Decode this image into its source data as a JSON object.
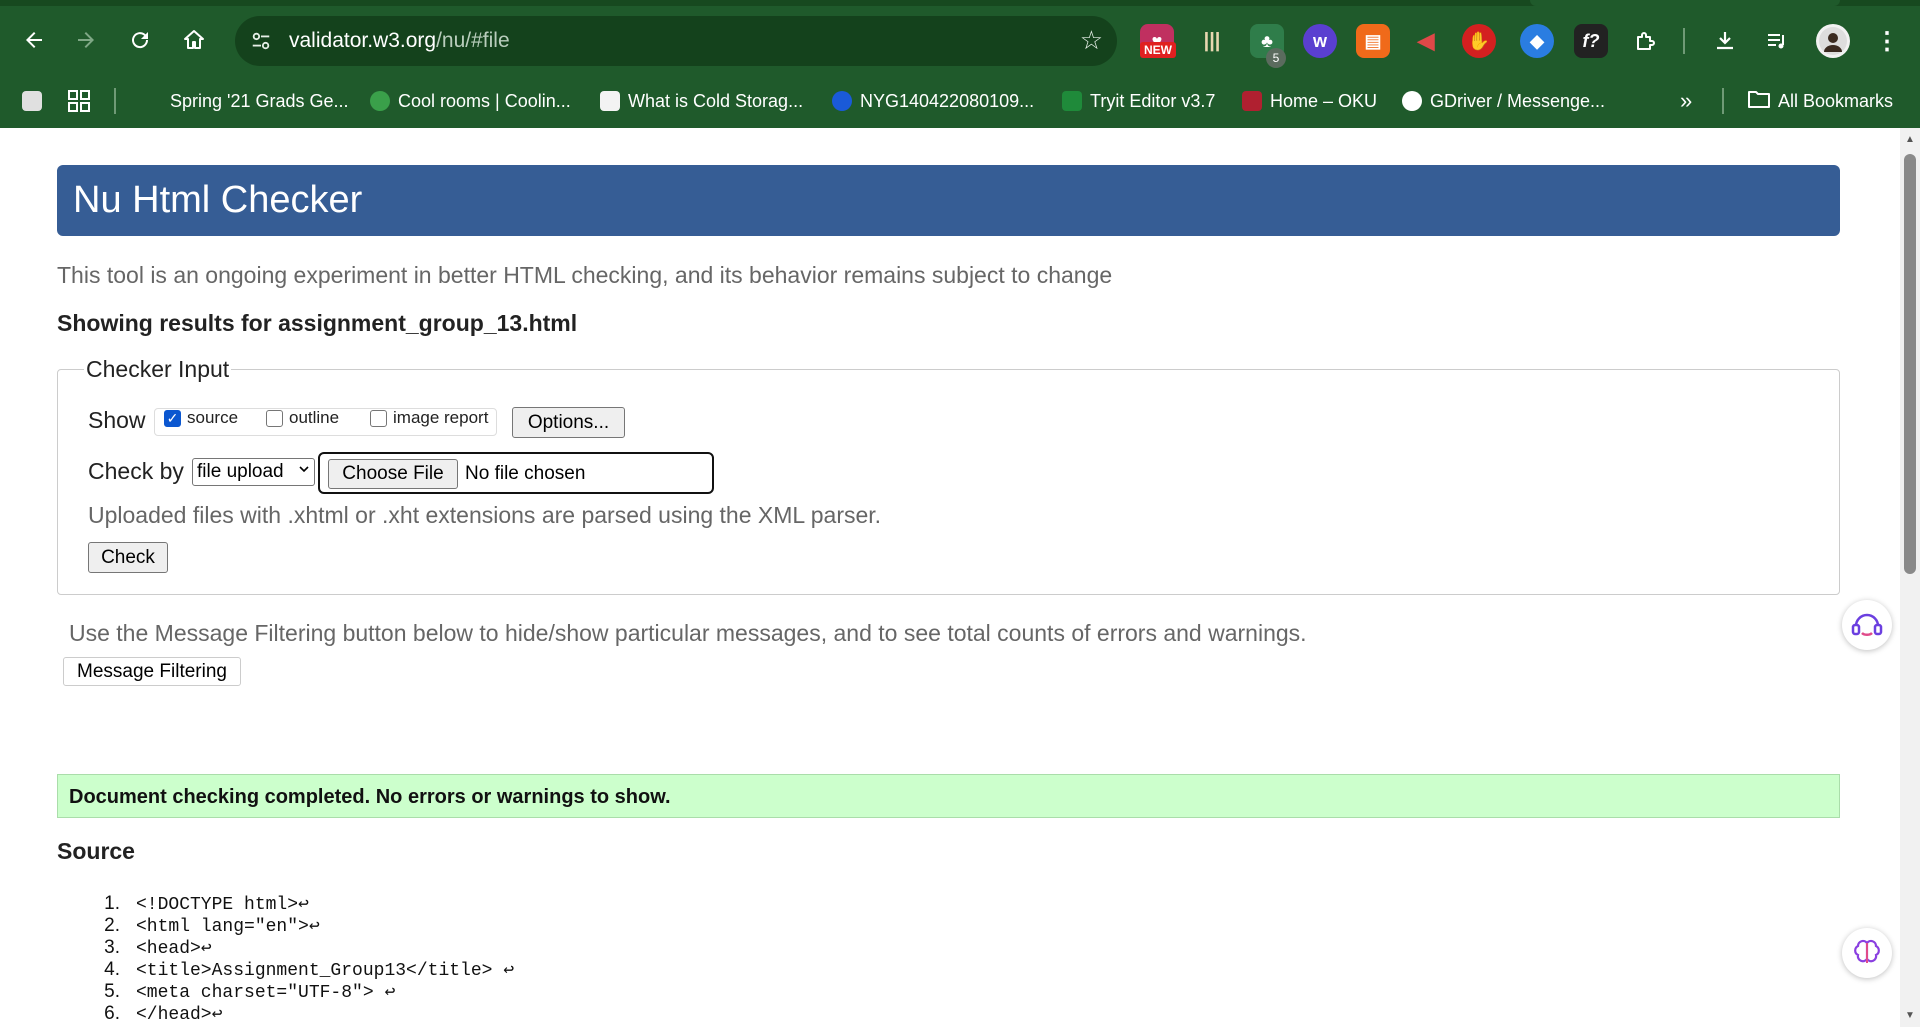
{
  "browser": {
    "url_host": "validator.w3.org",
    "url_path": "/nu/#file",
    "badge_new": "NEW",
    "badge_count": "5",
    "bookmarks": [
      {
        "label": "Spring '21 Grads Ge..."
      },
      {
        "label": "Cool rooms | Coolin..."
      },
      {
        "label": "What is Cold Storag..."
      },
      {
        "label": "NYG140422080109..."
      },
      {
        "label": "Tryit Editor v3.7"
      },
      {
        "label": "Home – OKU"
      },
      {
        "label": "GDriver / Messenge..."
      }
    ],
    "overflow_label": "»",
    "all_bookmarks": "All Bookmarks",
    "icons": [
      "back-icon",
      "forward-icon",
      "reload-icon",
      "home-icon",
      "tune-icon",
      "star-icon",
      "download-icon",
      "media-icon",
      "profile-icon",
      "menu-icon"
    ]
  },
  "page": {
    "title": "Nu Html Checker",
    "intro": "This tool is an ongoing experiment in better HTML checking, and its behavior remains subject to change",
    "results_for": "Showing results for assignment_group_13.html",
    "input_legend": "Checker Input",
    "show_label": "Show",
    "show_options": [
      {
        "label": "source",
        "checked": true
      },
      {
        "label": "outline",
        "checked": false
      },
      {
        "label": "image report",
        "checked": false
      }
    ],
    "options_button": "Options...",
    "check_by_label": "Check by",
    "check_by_value": "file upload",
    "choose_file_button": "Choose File",
    "no_file_text": "No file chosen",
    "hint": "Uploaded files with .xhtml or .xht extensions are parsed using the XML parser.",
    "check_button": "Check",
    "filter_text": "Use the Message Filtering button below to hide/show particular messages, and to see total counts of errors and warnings.",
    "filter_button": "Message Filtering",
    "success_message": "Document checking completed. No errors or warnings to show.",
    "source_heading": "Source",
    "source_lines": [
      {
        "num": "1.",
        "code": "<!DOCTYPE html>↩"
      },
      {
        "num": "2.",
        "code": "<html lang=\"en\">↩"
      },
      {
        "num": "3.",
        "code": "<head>↩"
      },
      {
        "num": "4.",
        "code": "<title>Assignment_Group13</title> ↩"
      },
      {
        "num": "5.",
        "code": "<meta charset=\"UTF-8\"> ↩"
      },
      {
        "num": "6.",
        "code": "</head>↩"
      }
    ]
  },
  "colors": {
    "chrome": "#1f5a2b",
    "header_bar": "#365d95",
    "success_bg": "#ccffcc"
  }
}
